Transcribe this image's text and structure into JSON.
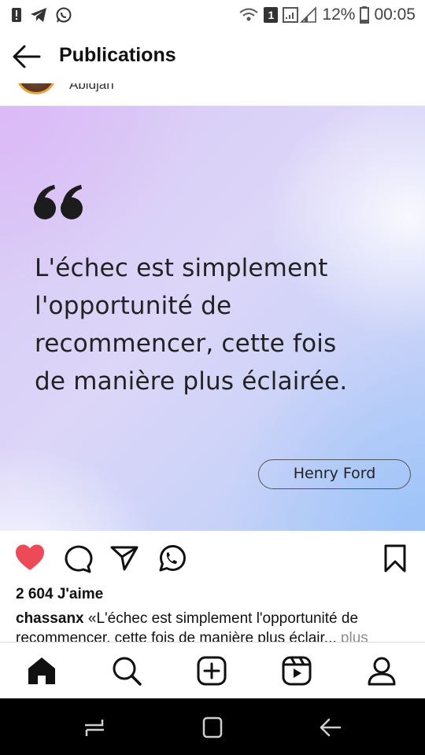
{
  "status_bar": {
    "battery_percent": "12%",
    "time": "00:05",
    "sim_badge": "1",
    "icons": [
      "alert-icon",
      "telegram-icon",
      "whatsapp-icon",
      "wifi-icon",
      "signal-icon",
      "battery-icon"
    ]
  },
  "header": {
    "title": "Publications",
    "back_icon": "arrow-left-icon"
  },
  "post": {
    "location": "Abidjan",
    "image": {
      "quote_lines": [
        "L'échec est simplement",
        "l'opportunité de",
        "recommencer, cette fois",
        "de manière plus éclairée."
      ],
      "author": "Henry Ford"
    },
    "actions": [
      "heart-icon",
      "comment-icon",
      "share-icon",
      "whatsapp-icon",
      "bookmark-icon"
    ],
    "like_color": "#ed4956",
    "likes_text": "2 604 J'aime",
    "caption_user": "chassanx",
    "caption_text": " «L'échec est simplement l'opportunité de recommencer, cette fois de manière plus éclair...",
    "more_label": "plus"
  },
  "bottom_nav": [
    "home-icon",
    "search-icon",
    "new-post-icon",
    "reels-icon",
    "profile-icon"
  ],
  "system_nav": [
    "recents-icon",
    "home-square-icon",
    "back-icon"
  ]
}
